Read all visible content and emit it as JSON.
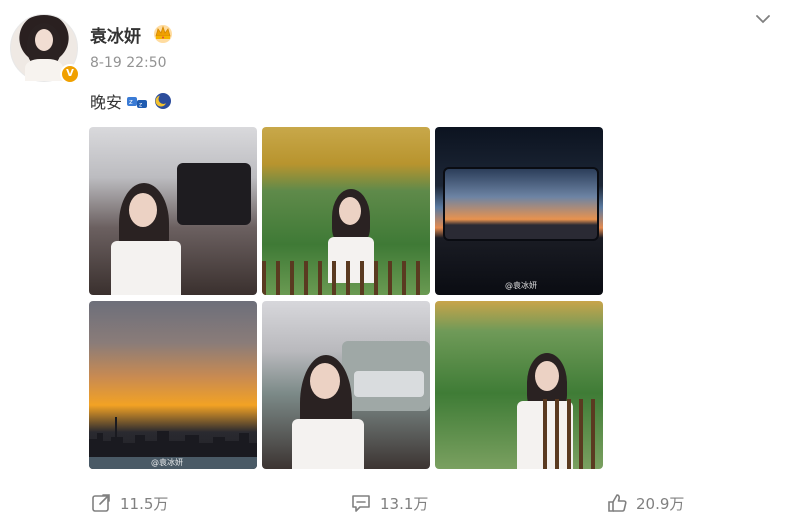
{
  "user": {
    "name": "袁冰妍",
    "badge": "V"
  },
  "post": {
    "timestamp": "8-19 22:50",
    "text": "晚安",
    "emoji": [
      "sleep-zz-emoji",
      "crescent-moon-emoji"
    ]
  },
  "photos": [
    {
      "name": "photo-1"
    },
    {
      "name": "photo-2"
    },
    {
      "name": "photo-3",
      "watermark": "@袁冰妍"
    },
    {
      "name": "photo-4",
      "watermark": "@袁冰妍"
    },
    {
      "name": "photo-5"
    },
    {
      "name": "photo-6"
    }
  ],
  "actions": {
    "repost": {
      "count": "11.5万",
      "icon": "share-icon"
    },
    "comment": {
      "count": "13.1万",
      "icon": "comment-icon"
    },
    "like": {
      "count": "20.9万",
      "icon": "thumbs-up-icon"
    }
  },
  "colors": {
    "accent": "#f0a000",
    "muted": "#939393",
    "text": "#333333"
  }
}
